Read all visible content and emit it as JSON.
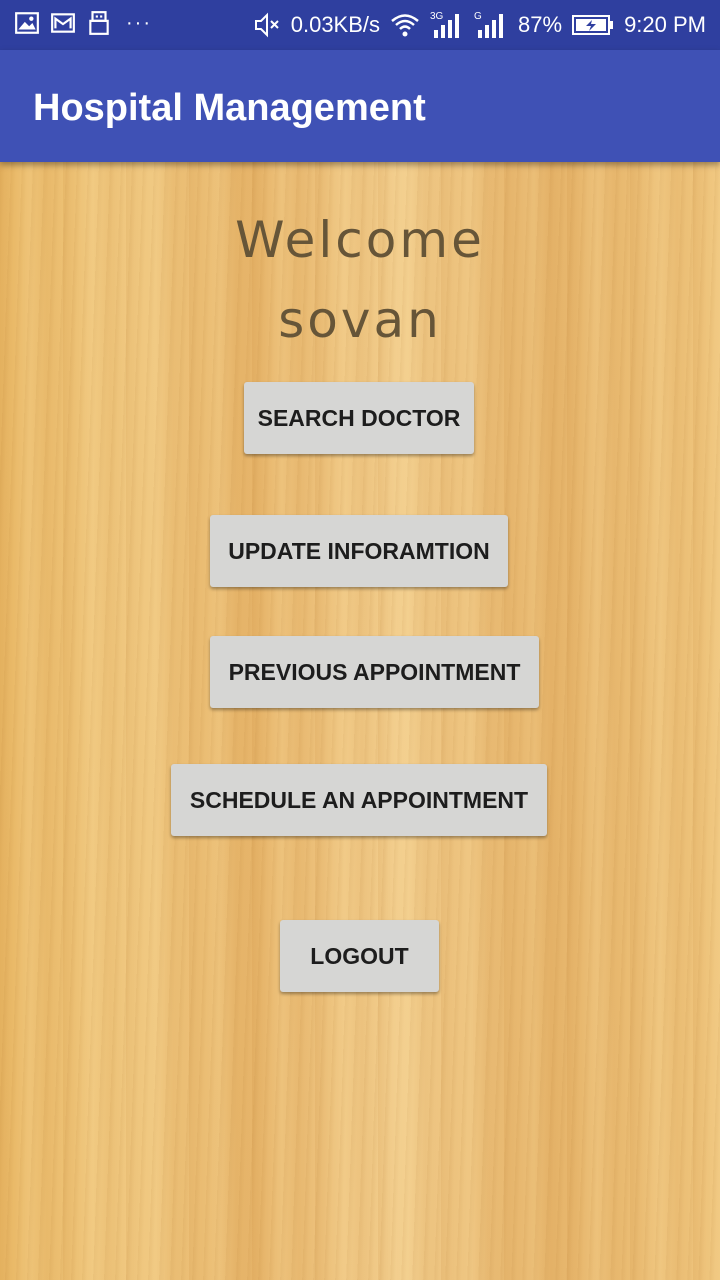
{
  "status_bar": {
    "icons_left": [
      "gallery-icon",
      "gmail-icon",
      "usb-icon"
    ],
    "overflow": "···",
    "mute_icon": "mute-icon",
    "data_speed": "0.03KB/s",
    "wifi_icon": "wifi-icon",
    "sim1_label": "3G",
    "sim2_label": "G",
    "battery": "87%",
    "time": "9:20 PM"
  },
  "app_bar": {
    "title": "Hospital Management",
    "color": "#3f51b5"
  },
  "main": {
    "welcome_line1": "Welcome",
    "welcome_line2": "sovan",
    "buttons": {
      "search_doctor": "SEARCH DOCTOR",
      "update_information": "UPDATE INFORAMTION",
      "previous_appointment": "PREVIOUS APPOINTMENT",
      "schedule_appointment": "SCHEDULE AN APPOINTMENT",
      "logout": "LOGOUT"
    }
  }
}
